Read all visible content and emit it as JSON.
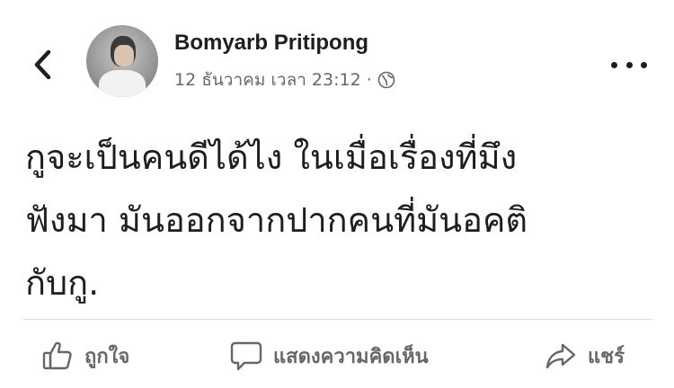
{
  "header": {
    "author_name": "Bomyarb Pritipong",
    "timestamp": "12 ธันวาคม เวลา 23:12",
    "separator": "·",
    "audience_icon": "globe-icon",
    "back_icon": "chevron-left-icon",
    "more_icon": "more-horizontal-icon"
  },
  "post": {
    "lines": [
      "กูจะเป็นคนดีได้ไง ในเมื่อเรื่องที่มึง",
      "ฟังมา มันออกจากปากคนที่มันอคติ",
      "กับกู."
    ]
  },
  "actions": {
    "like_label": "ถูกใจ",
    "comment_label": "แสดงความคิดเห็น",
    "share_label": "แชร์"
  },
  "colors": {
    "text": "#1c1e21",
    "secondary": "#65676b",
    "divider": "#dadde1"
  }
}
